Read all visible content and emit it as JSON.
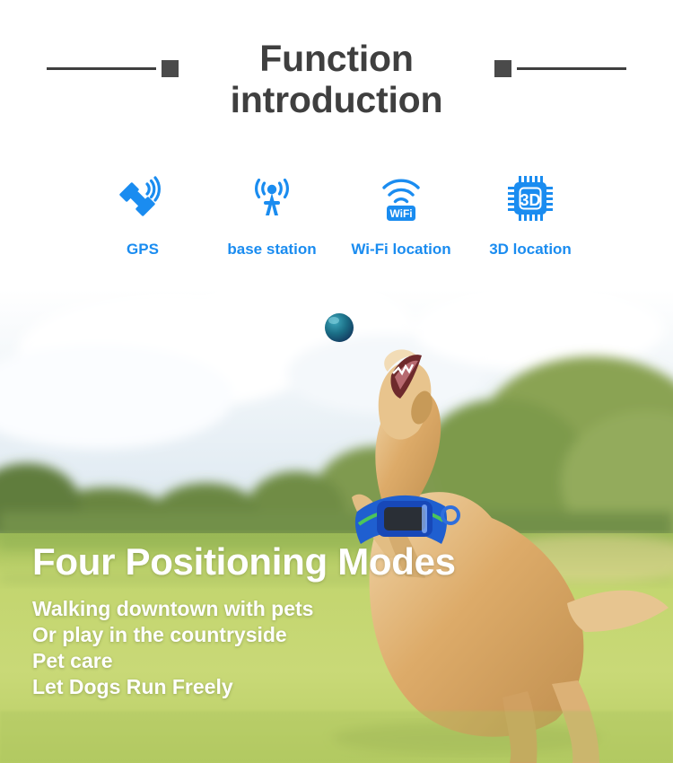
{
  "header": {
    "title_line1": "Function",
    "title_line2": "introduction",
    "title_color": "#3f3f3f",
    "deco_color": "#4a4a4a"
  },
  "features": {
    "accent_color": "#1a8cf0",
    "items": [
      {
        "icon": "gps-satellite-icon",
        "label": "GPS"
      },
      {
        "icon": "base-station-tower-icon",
        "label": "base station"
      },
      {
        "icon": "wifi-icon",
        "label": "Wi-Fi location",
        "icon_text": "WiFi"
      },
      {
        "icon": "chip-3d-icon",
        "label": "3D location",
        "icon_text": "3D"
      }
    ]
  },
  "photo": {
    "headline": "Four Positioning Modes",
    "sublines": [
      "Walking downtown with pets",
      "Or play in the countryside",
      "Pet care",
      "Let Dogs Run Freely"
    ],
    "scene": {
      "description": "golden-retriever-leaping-for-ball-on-golf-course",
      "sky_color": "#dfe9f2",
      "grass_color": "#b9cf63",
      "tree_color": "#7f9a4e",
      "ball_color": "#1c6f82",
      "collar_color": "#1f5fd0",
      "collar_stripe_color": "#4cc55a",
      "device_screen_color": "#2a2f36",
      "dog_color": "#d9a766"
    }
  }
}
